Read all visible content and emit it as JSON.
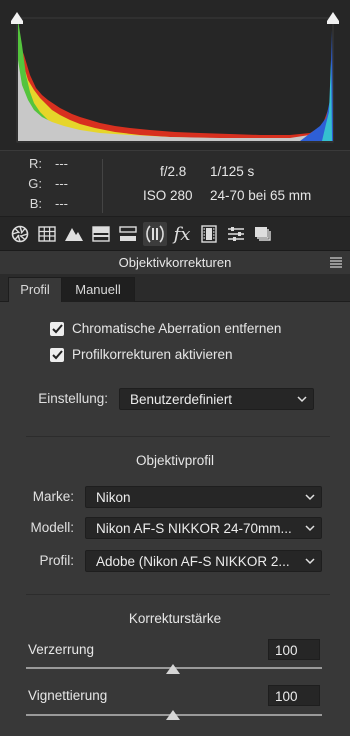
{
  "readout": {
    "r_label": "R:",
    "r_value": "---",
    "g_label": "G:",
    "g_value": "---",
    "b_label": "B:",
    "b_value": "---",
    "aperture": "f/2.8",
    "shutter": "1/125 s",
    "iso": "ISO 280",
    "lens": "24-70 bei 65 mm"
  },
  "toolbar": {
    "icons": [
      "aperture-icon",
      "grid-icon",
      "mountains-icon",
      "split-toning-icon",
      "split-icon",
      "lens-icon",
      "fx-icon",
      "filmstrip-icon",
      "sliders-icon",
      "presets-icon"
    ],
    "active": "lens-icon"
  },
  "panel": {
    "title": "Objektivkorrekturen",
    "tabs": [
      "Profil",
      "Manuell"
    ],
    "active_tab": "Profil"
  },
  "profile": {
    "chromatic_label": "Chromatische Aberration entfernen",
    "chromatic_checked": true,
    "profile_corr_label": "Profilkorrekturen aktivieren",
    "profile_corr_checked": true,
    "setting_label": "Einstellung:",
    "setting_value": "Benutzerdefiniert",
    "section_title": "Objektivprofil",
    "make_label": "Marke:",
    "make_value": "Nikon",
    "model_label": "Modell:",
    "model_value": "Nikon AF-S NIKKOR 24-70mm...",
    "profile_label": "Profil:",
    "profile_value": "Adobe (Nikon AF-S NIKKOR 2..."
  },
  "amount": {
    "section_title": "Korrekturstärke",
    "distortion_label": "Verzerrung",
    "distortion_value": "100",
    "vignetting_label": "Vignettierung",
    "vignetting_value": "100"
  },
  "colors": {
    "panel_bg": "#383838",
    "histogram_bg": "#262626",
    "field_bg": "#262626"
  }
}
